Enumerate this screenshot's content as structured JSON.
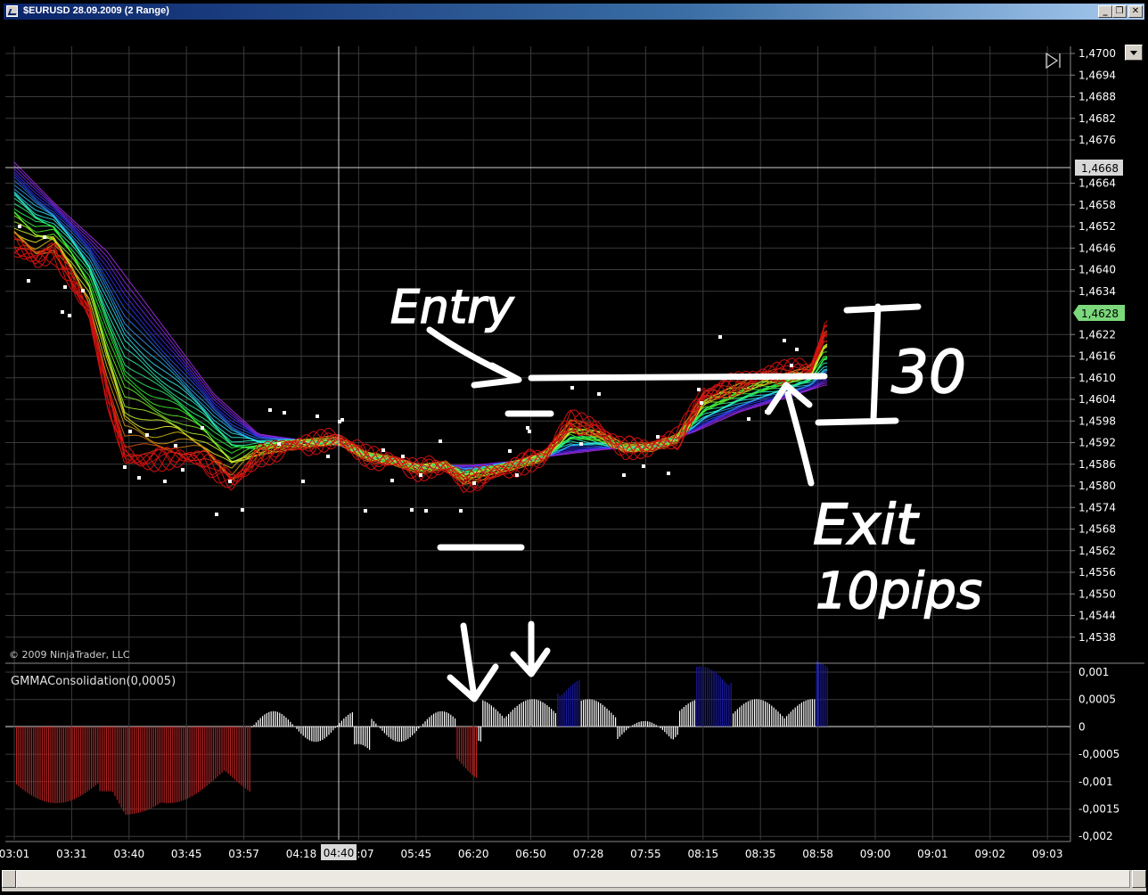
{
  "window": {
    "title": "$EURUSD  28.09.2009 (2 Range)",
    "buttons": [
      "minimize",
      "restore",
      "close"
    ]
  },
  "colors": {
    "background": "#000000",
    "grid": "#3a3a3a",
    "up_histogram": "#1a1aa0",
    "down_histogram": "#b22222",
    "neutral_histogram": "#ffffff",
    "last_price_tag": "#7bd87b"
  },
  "price_axis": {
    "ticks": [
      "1,4700",
      "1,4694",
      "1,4688",
      "1,4682",
      "1,4676",
      "1,4664",
      "1,4658",
      "1,4652",
      "1,4646",
      "1,4640",
      "1,4634",
      "1,4622",
      "1,4616",
      "1,4610",
      "1,4604",
      "1,4598",
      "1,4592",
      "1,4586",
      "1,4580",
      "1,4574",
      "1,4568",
      "1,4562",
      "1,4556",
      "1,4550",
      "1,4544",
      "1,4538"
    ],
    "crosshair_price": "1,4668",
    "last_price": "1,4628"
  },
  "indicator": {
    "name": "GMMAConsolidation(0,0005)",
    "ticks": [
      "0,001",
      "0,0005",
      "0",
      "-0,0005",
      "-0,001",
      "-0,0015",
      "-0,002"
    ]
  },
  "time_axis": {
    "ticks": [
      "03:01",
      "03:31",
      "03:40",
      "03:45",
      "03:57",
      "04:18",
      "05:07",
      "05:45",
      "06:20",
      "06:50",
      "07:28",
      "07:55",
      "08:15",
      "08:35",
      "08:58",
      "09:00",
      "09:01",
      "09:02",
      "09:03"
    ],
    "crosshair_time": "04:40"
  },
  "copyright": "© 2009 NinjaTrader, LLC",
  "annotations": {
    "entry": "Entry",
    "exit": "Exit",
    "exit_detail": "10pips",
    "range": "30"
  },
  "icons": [
    "chart-icon",
    "minimize-icon",
    "restore-icon",
    "close-icon",
    "tab-slide-icon",
    "dropdown-arrow-icon"
  ]
}
